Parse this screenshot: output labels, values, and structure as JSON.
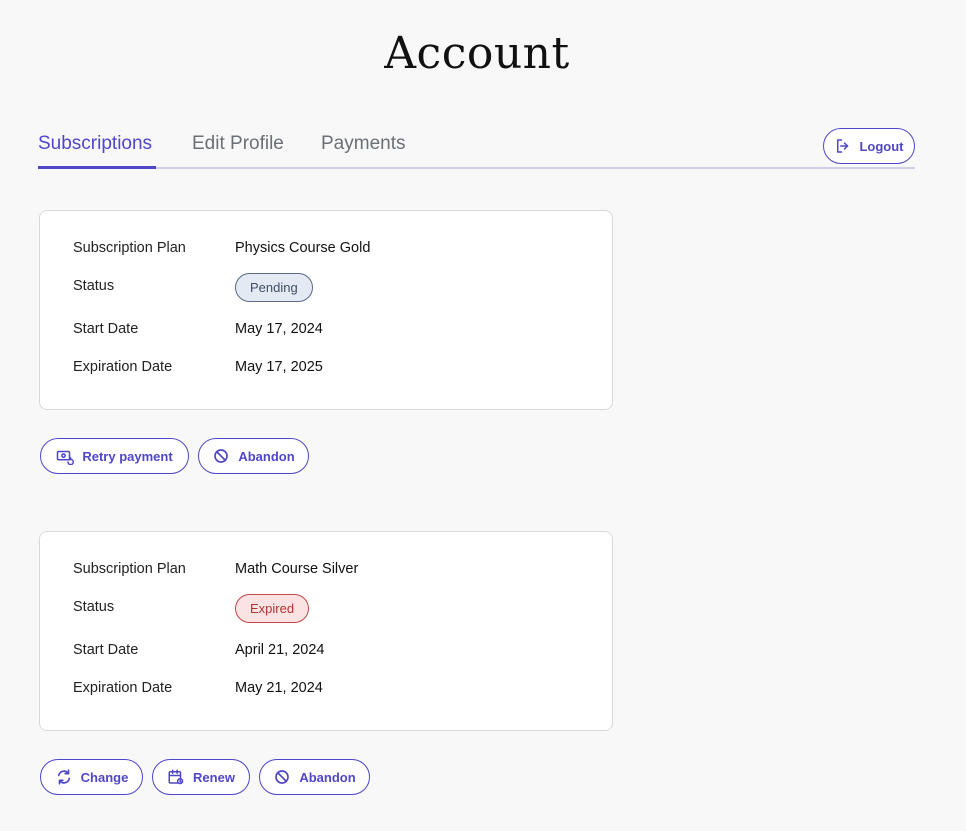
{
  "page": {
    "title": "Account"
  },
  "tabs": [
    {
      "label": "Subscriptions",
      "active": true
    },
    {
      "label": "Edit Profile",
      "active": false
    },
    {
      "label": "Payments",
      "active": false
    }
  ],
  "header": {
    "logout_label": "Logout"
  },
  "labels": {
    "plan": "Subscription Plan",
    "status": "Status",
    "start": "Start Date",
    "expiration": "Expiration Date"
  },
  "subscriptions": [
    {
      "plan": "Physics Course Gold",
      "status": "Pending",
      "start_date": "May 17, 2024",
      "expiration_date": "May 17, 2025",
      "actions": [
        {
          "label": "Retry payment",
          "icon": "retry-payment-icon"
        },
        {
          "label": "Abandon",
          "icon": "ban-icon"
        }
      ]
    },
    {
      "plan": "Math Course Silver",
      "status": "Expired",
      "start_date": "April 21, 2024",
      "expiration_date": "May 21, 2024",
      "actions": [
        {
          "label": "Change",
          "icon": "refresh-icon"
        },
        {
          "label": "Renew",
          "icon": "calendar-renew-icon"
        },
        {
          "label": "Abandon",
          "icon": "ban-icon"
        }
      ]
    }
  ],
  "colors": {
    "accent": "#4f46c8",
    "pending_bg": "#e4eaf3",
    "expired_bg": "#fbe3e3",
    "expired_text": "#b43333"
  }
}
